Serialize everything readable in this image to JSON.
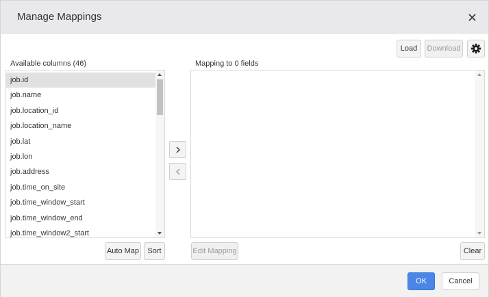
{
  "dialog": {
    "title": "Manage Mappings"
  },
  "toolbar": {
    "load_label": "Load",
    "download_label": "Download"
  },
  "available": {
    "label": "Available columns (46)",
    "items": [
      "job.id",
      "job.name",
      "job.location_id",
      "job.location_name",
      "job.lat",
      "job.lon",
      "job.address",
      "job.time_on_site",
      "job.time_window_start",
      "job.time_window_end",
      "job.time_window2_start"
    ],
    "selected_index": 0
  },
  "mapping": {
    "label": "Mapping to 0 fields"
  },
  "actions": {
    "auto_map_label": "Auto Map",
    "sort_label": "Sort",
    "edit_mapping_label": "Edit Mapping",
    "clear_label": "Clear"
  },
  "footer": {
    "ok_label": "OK",
    "cancel_label": "Cancel"
  },
  "colors": {
    "primary": "#4a86e8",
    "header_bg": "#e9e9eb",
    "selected_row": "#e1e1e1"
  },
  "icons": {
    "close": "close-icon",
    "settings": "gear-icon",
    "move_right": "chevron-right-icon",
    "move_left": "chevron-left-icon"
  }
}
